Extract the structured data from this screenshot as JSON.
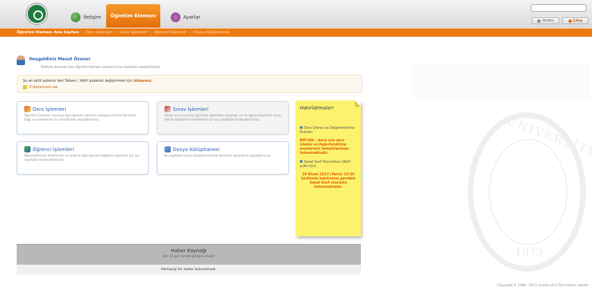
{
  "header": {
    "tabs": [
      {
        "label": "İletişim"
      },
      {
        "label": "Öğretim Elemanı"
      },
      {
        "label": "Ayarlar"
      }
    ],
    "buttons": {
      "yardim": "Yardım",
      "cikis": "Çıkış"
    }
  },
  "subnav": {
    "items": [
      {
        "label": "Öğretim Elemanı Ana Sayfası"
      },
      {
        "label": "Ders İşlemleri"
      },
      {
        "label": "Sınav İşlemleri"
      },
      {
        "label": "Öğrenci İşlemleri"
      },
      {
        "label": "Dosya Kütüphanesi"
      }
    ]
  },
  "welcome": {
    "title": "Hoşgeldiniz Mesut Özonur",
    "description": "Sisteme bulunan tüm öğretim elemanı araçlarına bu sayfadan ulaşabilirsiniz."
  },
  "notice": {
    "line1_prefix": "Şu an aktif şubeniz Veri Tabanı I. Aktif şubenizi değiştirmek için",
    "line1_link": "tıklayınız.",
    "line2": "3 duyurunuz var."
  },
  "cards": [
    {
      "title": "Ders İşlemleri",
      "description": "Öğretim Elemanı ve/veya baş öğretim elemanı olduğunuz tüm derslerin bilgi ve işlemlerine bu misafirden ulaşabilirsiniz."
    },
    {
      "title": "Sınav İşlemleri",
      "description": "Sınav ve sınavlarla ilgili tüm işlemlere ulaşmak ve da öğrencilerinizin sınav tekrar taleplerini listelemek için bu sayfadan kullanabilirsiniz."
    },
    {
      "title": "Öğrenci İşlemleri",
      "description": "Öğrencilerinizi listelemek ve onlarla ilgili ayrıntılı bilgilere ulaşmak için bu sayfadan kullanabilirsiniz."
    },
    {
      "title": "Dosya Kütüphanesi",
      "description": "Bu sayfada dosya kütüphanenizde bulunan dosyalara ulaşabilirsiniz."
    }
  ],
  "reminders": {
    "title": "Hatırlatmalar!",
    "item1": "Ders İzleme ve Değerlendirme Esasları",
    "item1_note": "BPF106 - dersi için ders izleme ve değerlendirme esaslarının tamamlanması bulunmaktadır.",
    "item2": "Sanal Sınıf Oturumları (Aktif şube için)",
    "item2_note": "29 Nisan 2013 (Yarın) 13:30 tarihinde katılmanız gereken Sanal Sınıf oturumu bulunmaktadır."
  },
  "news": {
    "title": "Haber Kaynağı",
    "subtitle": "Son 15 gün içinde gelişen olaylar",
    "empty": "Herhangi bir haber bulunamadı."
  },
  "watermark": {
    "text": "ÜNİVERSİTESİ",
    "year": "1973"
  },
  "footer": {
    "copyright": "Copyright © 1998 - 2013, Enocta v6.3 Tüm hakları saklıdır."
  }
}
